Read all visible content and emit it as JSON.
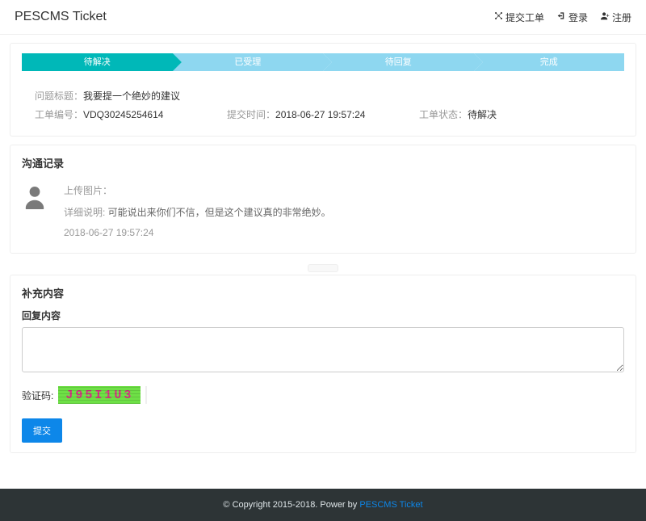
{
  "header": {
    "brand": "PESCMS Ticket",
    "links": {
      "submit": "提交工单",
      "login": "登录",
      "register": "注册"
    }
  },
  "steps": [
    "待解决",
    "已受理",
    "待回复",
    "完成"
  ],
  "ticket": {
    "title_label": "问题标题：",
    "title_value": "我要提一个绝妙的建议",
    "number_label": "工单编号：",
    "number_value": "VDQ30245254614",
    "time_label": "提交时间：",
    "time_value": "2018-06-27 19:57:24",
    "status_label": "工单状态：",
    "status_value": "待解决"
  },
  "sections": {
    "history": "沟通记录",
    "supplement": "补充内容"
  },
  "message": {
    "upload_label": "上传图片：",
    "detail_label": "详细说明: ",
    "detail_value": "可能说出来你们不信，但是这个建议真的非常绝妙。",
    "time": "2018-06-27 19:57:24"
  },
  "form": {
    "reply_label": "回复内容",
    "captcha_label": "验证码:",
    "captcha_text": "J95I1U3",
    "submit": "提交"
  },
  "footer": {
    "copyright": "© Copyright 2015-2018. Power by ",
    "link": "PESCMS Ticket"
  }
}
